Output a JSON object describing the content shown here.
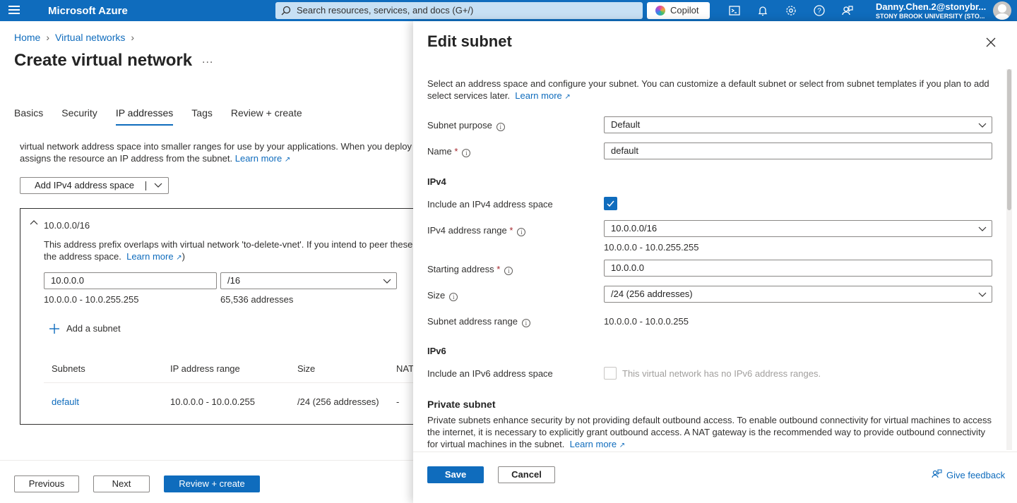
{
  "topbar": {
    "brand": "Microsoft Azure",
    "search_placeholder": "Search resources, services, and docs (G+/)",
    "copilot_label": "Copilot",
    "user_email": "Danny.Chen.2@stonybr...",
    "user_org": "STONY BROOK UNIVERSITY (STO..."
  },
  "breadcrumb": {
    "items": [
      "Home",
      "Virtual networks"
    ]
  },
  "page": {
    "title": "Create virtual network",
    "more": "...",
    "tabs": [
      "Basics",
      "Security",
      "IP addresses",
      "Tags",
      "Review + create"
    ],
    "active_tab": "IP addresses",
    "desc_line1": "virtual network address space into smaller ranges for use by your applications. When you deploy r",
    "desc_line2": "assigns the resource an IP address from the subnet.",
    "learn_more": "Learn more",
    "add_space_label": "Add IPv4 address space",
    "space": {
      "header": "10.0.0.0/16",
      "warn_line1": "This address prefix overlaps with virtual network 'to-delete-vnet'. If you intend to peer these",
      "warn_line2": "the address space.",
      "learn_more": "Learn more",
      "after_link": ")",
      "address": "10.0.0.0",
      "prefix": "/16",
      "range": "10.0.0.0 - 10.0.255.255",
      "count": "65,536 addresses",
      "add_subnet": "Add a subnet",
      "columns": [
        "Subnets",
        "IP address range",
        "Size",
        "NAT"
      ],
      "rows": [
        [
          "default",
          "10.0.0.0 - 10.0.0.255",
          "/24 (256 addresses)",
          "-"
        ]
      ]
    },
    "footer": {
      "previous": "Previous",
      "next": "Next",
      "review": "Review + create"
    }
  },
  "panel": {
    "title": "Edit subnet",
    "intro_line1": "Select an address space and configure your subnet. You can customize a default subnet or select from subnet templates if you plan to add",
    "intro_line2": "select services later.",
    "learn_more": "Learn more",
    "purpose_label": "Subnet purpose",
    "purpose_value": "Default",
    "name_label": "Name",
    "name_value": "default",
    "ipv4_heading": "IPv4",
    "include_ipv4_label": "Include an IPv4 address space",
    "ipv4_checked": true,
    "ipv4_range_label": "IPv4 address range",
    "ipv4_range_value": "10.0.0.0/16",
    "ipv4_range_text": "10.0.0.0 - 10.0.255.255",
    "start_label": "Starting address",
    "start_value": "10.0.0.0",
    "size_label": "Size",
    "size_value": "/24 (256 addresses)",
    "subnet_range_label": "Subnet address range",
    "subnet_range_value": "10.0.0.0 - 10.0.0.255",
    "ipv6_heading": "IPv6",
    "include_ipv6_label": "Include an IPv6 address space",
    "ipv6_checked": false,
    "ipv6_note": "This virtual network has no IPv6 address ranges.",
    "private_heading": "Private subnet",
    "private_line1": "Private subnets enhance security by not providing default outbound access. To enable outbound connectivity for virtual machines to access",
    "private_line2": "the internet, it is necessary to explicitly grant outbound access. A NAT gateway is the recommended way to provide outbound connectivity",
    "private_line3": "for virtual machines in the subnet.",
    "save": "Save",
    "cancel": "Cancel",
    "feedback": "Give feedback"
  },
  "colors": {
    "accent": "#0f6cbd",
    "topbar": "#0f6cbd"
  }
}
